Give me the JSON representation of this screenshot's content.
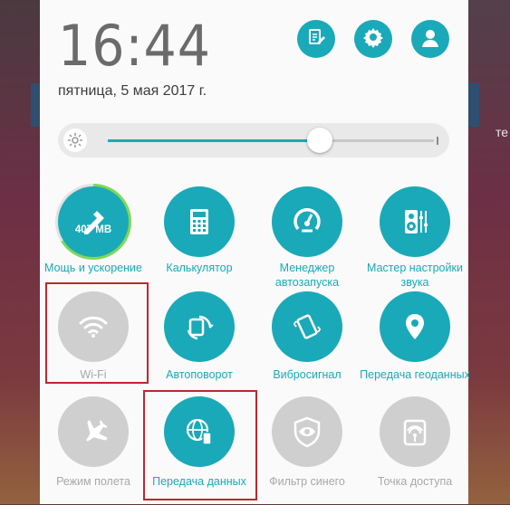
{
  "clock": {
    "time": "16:44",
    "date": "пятница, 5 мая 2017 г."
  },
  "header": {
    "icons": [
      "edit-icon",
      "gear-icon",
      "avatar"
    ]
  },
  "brightness": {
    "level": 0.65
  },
  "background": {
    "right_text": "те"
  },
  "tiles": [
    {
      "label": "Мощь и ускорение",
      "state": "on",
      "icon": "boost-icon",
      "badge": "407 MB"
    },
    {
      "label": "Калькулятор",
      "state": "on",
      "icon": "calculator-icon"
    },
    {
      "label": "Менеджер автозапуска",
      "state": "on",
      "icon": "autostart-icon"
    },
    {
      "label": "Мастер настройки звука",
      "state": "on",
      "icon": "sound-settings-icon"
    },
    {
      "label": "Wi-Fi",
      "state": "off",
      "icon": "wifi-icon"
    },
    {
      "label": "Автоповорот",
      "state": "on",
      "icon": "autorotate-icon"
    },
    {
      "label": "Вибросигнал",
      "state": "on",
      "icon": "vibration-icon"
    },
    {
      "label": "Передача геоданных",
      "state": "on",
      "icon": "location-icon"
    },
    {
      "label": "Режим полета",
      "state": "off",
      "icon": "airplane-icon"
    },
    {
      "label": "Передача данных",
      "state": "on",
      "icon": "mobile-data-icon"
    },
    {
      "label": "Фильтр синего",
      "state": "off",
      "icon": "blue-filter-icon"
    },
    {
      "label": "Точка доступа",
      "state": "off",
      "icon": "hotspot-icon"
    }
  ],
  "colors": {
    "accent": "#1aa9b8",
    "off": "#cfcfcf",
    "highlight": "#c0262d"
  }
}
